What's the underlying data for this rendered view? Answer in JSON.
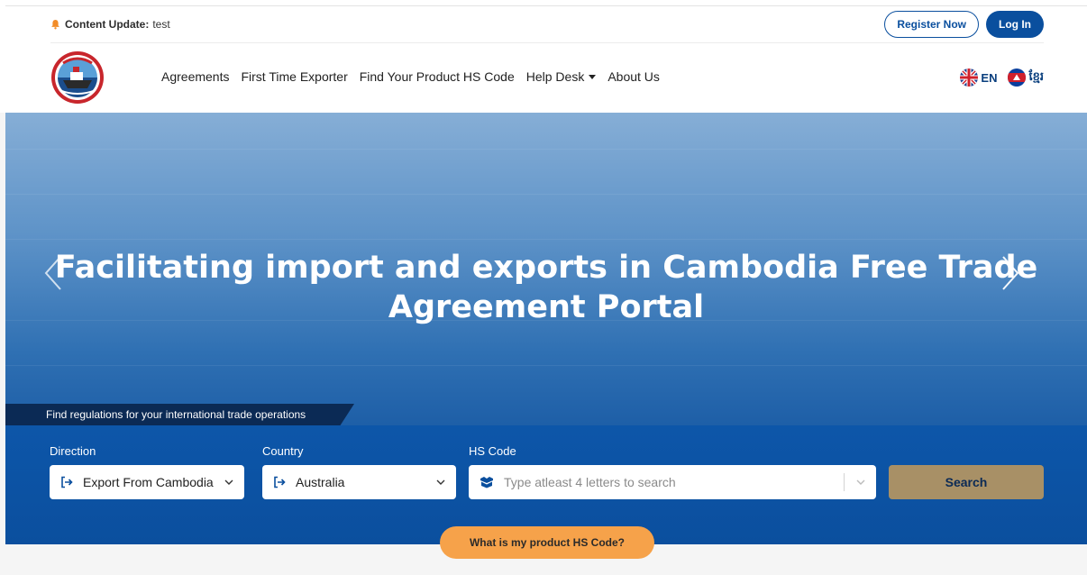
{
  "notice": {
    "label": "Content Update:",
    "text": "test"
  },
  "auth": {
    "register": "Register Now",
    "login": "Log In"
  },
  "nav": {
    "agreements": "Agreements",
    "first_time_exporter": "First Time Exporter",
    "find_hs_code": "Find Your Product HS Code",
    "help_desk": "Help Desk",
    "about_us": "About Us"
  },
  "lang": {
    "en": "EN",
    "km": "ខ្មែរ"
  },
  "hero": {
    "title_line1": "Facilitating import and exports in Cambodia Free Trade",
    "title_line2": "Agreement Portal"
  },
  "tagline": "Find regulations for your international trade operations",
  "search": {
    "direction_label": "Direction",
    "direction_value": "Export From Cambodia",
    "country_label": "Country",
    "country_value": "Australia",
    "hs_label": "HS Code",
    "hs_placeholder": "Type atleast 4 letters to search",
    "button": "Search"
  },
  "hs_help_button": "What is my product HS Code?",
  "colors": {
    "brand_blue": "#0a4f9e",
    "search_button": "#a89066",
    "hs_help_button": "#f6a24a",
    "tagline_bg": "#0b2a55"
  },
  "icons": [
    "bell-icon",
    "logo-emblem",
    "uk-flag-icon",
    "cambodia-flag-icon",
    "chevron-left-icon",
    "chevron-right-icon",
    "sign-in-icon",
    "boxes-icon",
    "chevron-down-icon"
  ]
}
